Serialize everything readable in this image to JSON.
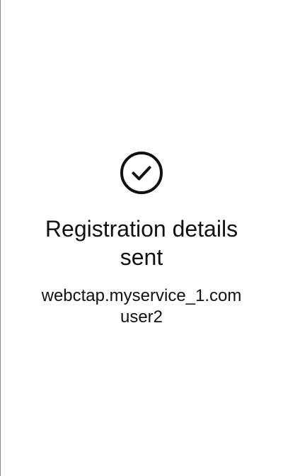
{
  "status": {
    "icon": "check-circle-icon",
    "title": "Registration details sent",
    "host": "webctap.myservice_1.com",
    "user": "user2"
  },
  "colors": {
    "background": "#ffffff",
    "text": "#111111",
    "icon": "#111111",
    "left_border": "#8a8a8a"
  }
}
